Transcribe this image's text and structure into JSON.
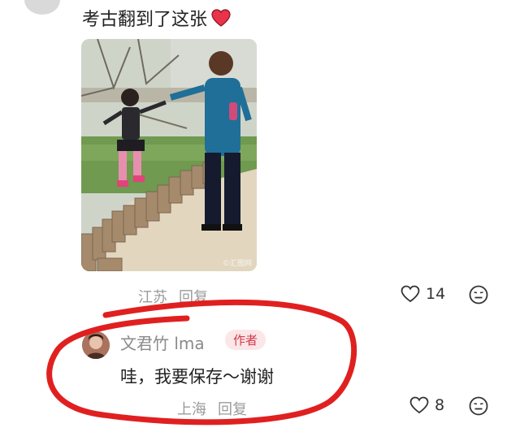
{
  "comment": {
    "text": "考古翻到了这张",
    "emoji": "heart-emoji",
    "photo_watermark": "©汇图网",
    "location": "江苏",
    "reply_label": "回复",
    "likes": "14"
  },
  "reply": {
    "user": "文君竹 lma",
    "badge": "作者",
    "text": "哇，我要保存～谢谢",
    "location": "上海",
    "reply_label": "回复",
    "likes": "8"
  },
  "colors": {
    "annotation_red": "#e02020",
    "badge_text": "#d23a4e",
    "badge_bg": "#fbe6e8",
    "heart_red": "#e8334a"
  }
}
